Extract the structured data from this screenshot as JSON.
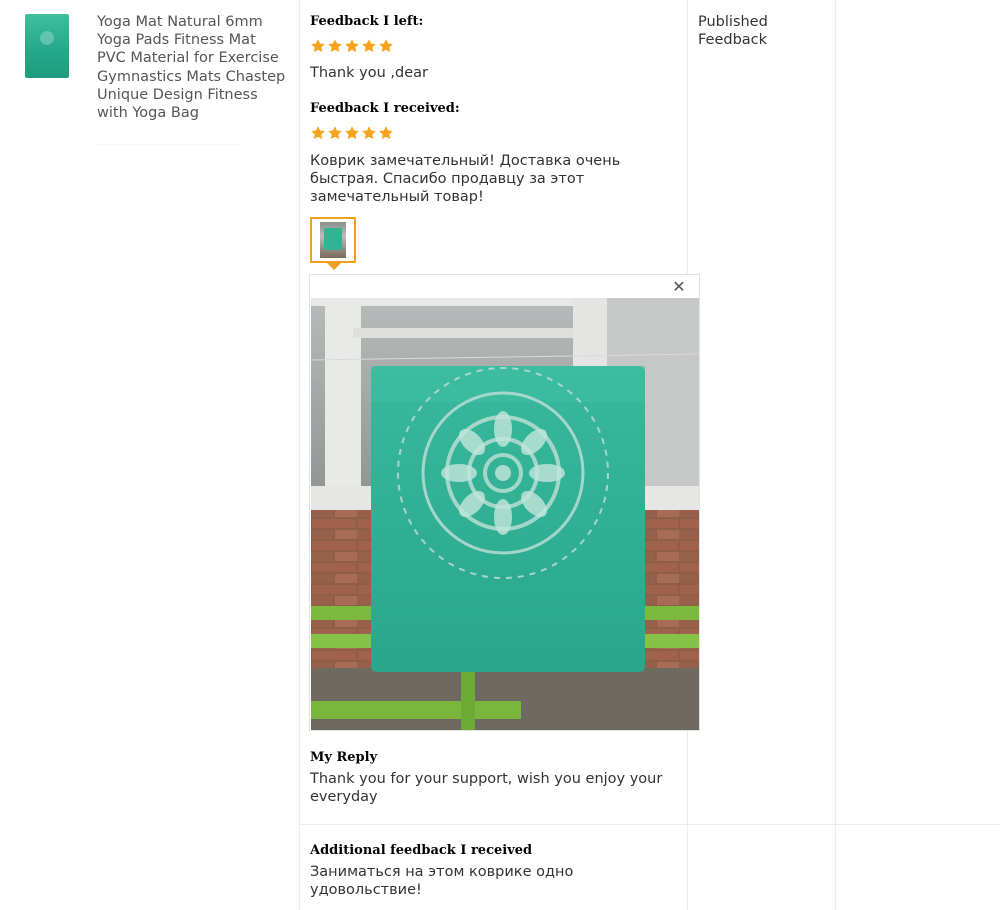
{
  "product": {
    "title": "Yoga Mat Natural 6mm Yoga Pads Fitness Mat PVC Material for Exercise Gymnastics Mats Chastep Unique Design Fitness with Yoga Bag",
    "thumbnail_icon": "yoga-mat-thumbnail"
  },
  "feedback_left": {
    "label": "Feedback I left:",
    "rating": 5,
    "text": "Thank you ,dear"
  },
  "feedback_received": {
    "label": "Feedback I received:",
    "rating": 5,
    "text": "Коврик замечательный! Доставка очень быстрая. Спасибо продавцу за этот замечательный товар!",
    "photo_thumbnail_icon": "photo-thumbnail",
    "viewer_close_icon": "close-icon"
  },
  "reply": {
    "label": "My Reply",
    "text": "Thank you for your support, wish you enjoy your everyday"
  },
  "additional": {
    "label": "Additional feedback I received",
    "text": "Заниматься на этом коврике одно удовольствие!"
  },
  "status": {
    "text": "Published Feedback"
  },
  "colors": {
    "star": "#f7a31b",
    "thumb_border": "#f0a020",
    "mat": "#33b497",
    "grid": "#ececec"
  }
}
